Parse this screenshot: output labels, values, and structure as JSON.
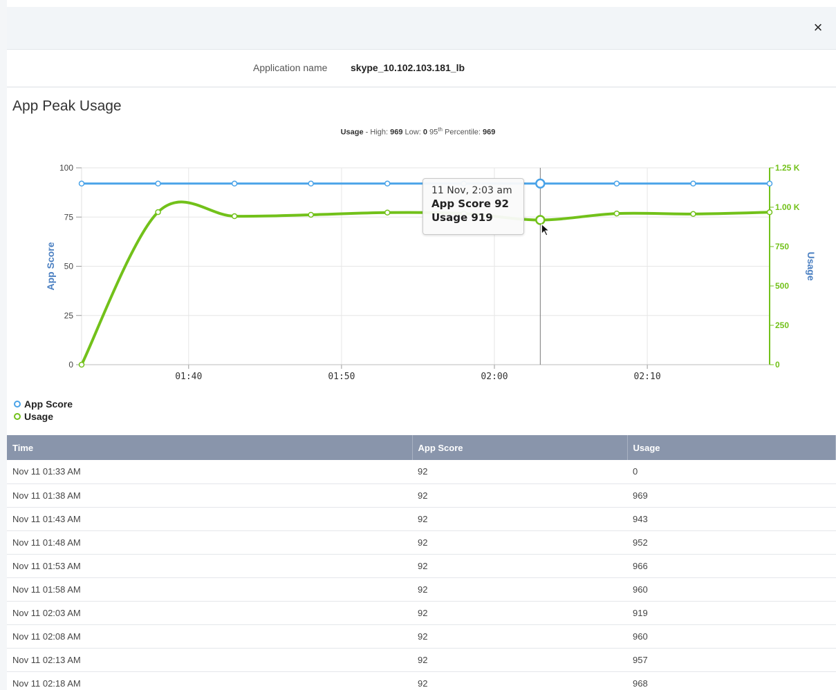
{
  "dialog": {
    "close_label": "×"
  },
  "app": {
    "name_label": "Application name",
    "name_value": "skype_10.102.103.181_lb"
  },
  "section": {
    "title": "App Peak Usage"
  },
  "summary": {
    "prefix": "Usage",
    "sep": " - High: ",
    "high": "969",
    "low_label": " Low: ",
    "low": "0",
    "pct_prefix": " 95",
    "pct_sup": "th",
    "pct_label": " Percentile: ",
    "pct": "969"
  },
  "tooltip": {
    "date": "11 Nov, 2:03 am",
    "score_line": "App Score 92",
    "usage_line": "Usage 919"
  },
  "legend": [
    {
      "label": "App Score",
      "color": "#4aa3e8"
    },
    {
      "label": "Usage",
      "color": "#72c11a"
    }
  ],
  "chart_data": {
    "type": "line",
    "x_labels": [
      "01:33",
      "01:38",
      "01:43",
      "01:48",
      "01:53",
      "01:58",
      "02:03",
      "02:08",
      "02:13",
      "02:18"
    ],
    "x_minutes": [
      93,
      98,
      103,
      108,
      113,
      118,
      123,
      128,
      133,
      138
    ],
    "x_tick_minutes": [
      100,
      110,
      120,
      130
    ],
    "x_tick_labels": [
      "01:40",
      "01:50",
      "02:00",
      "02:10"
    ],
    "series": [
      {
        "name": "App Score",
        "axis": "left",
        "color": "#4aa3e8",
        "values": [
          92,
          92,
          92,
          92,
          92,
          92,
          92,
          92,
          92,
          92
        ]
      },
      {
        "name": "Usage",
        "axis": "right",
        "color": "#72c11a",
        "values": [
          0,
          969,
          943,
          952,
          966,
          960,
          919,
          960,
          957,
          968
        ]
      }
    ],
    "left_axis": {
      "label": "App Score",
      "ticks": [
        0,
        25,
        50,
        75,
        100
      ],
      "tick_labels": [
        "0",
        "25",
        "50",
        "75",
        "100"
      ],
      "range": [
        0,
        100
      ],
      "color": "#4a7fc1"
    },
    "right_axis": {
      "label": "Usage",
      "ticks": [
        0,
        250,
        500,
        750,
        1000,
        1250
      ],
      "tick_labels": [
        "0",
        "250",
        "500",
        "750",
        "1.00 K",
        "1.25 K"
      ],
      "range": [
        0,
        1250
      ],
      "color": "#72c11a"
    },
    "highlight_index": 6,
    "grid": true,
    "legend_position": "bottom-left"
  },
  "table": {
    "headers": [
      "Time",
      "App Score",
      "Usage"
    ],
    "rows": [
      [
        "Nov 11 01:33 AM",
        "92",
        "0"
      ],
      [
        "Nov 11 01:38 AM",
        "92",
        "969"
      ],
      [
        "Nov 11 01:43 AM",
        "92",
        "943"
      ],
      [
        "Nov 11 01:48 AM",
        "92",
        "952"
      ],
      [
        "Nov 11 01:53 AM",
        "92",
        "966"
      ],
      [
        "Nov 11 01:58 AM",
        "92",
        "960"
      ],
      [
        "Nov 11 02:03 AM",
        "92",
        "919"
      ],
      [
        "Nov 11 02:08 AM",
        "92",
        "960"
      ],
      [
        "Nov 11 02:13 AM",
        "92",
        "957"
      ],
      [
        "Nov 11 02:18 AM",
        "92",
        "968"
      ]
    ]
  }
}
